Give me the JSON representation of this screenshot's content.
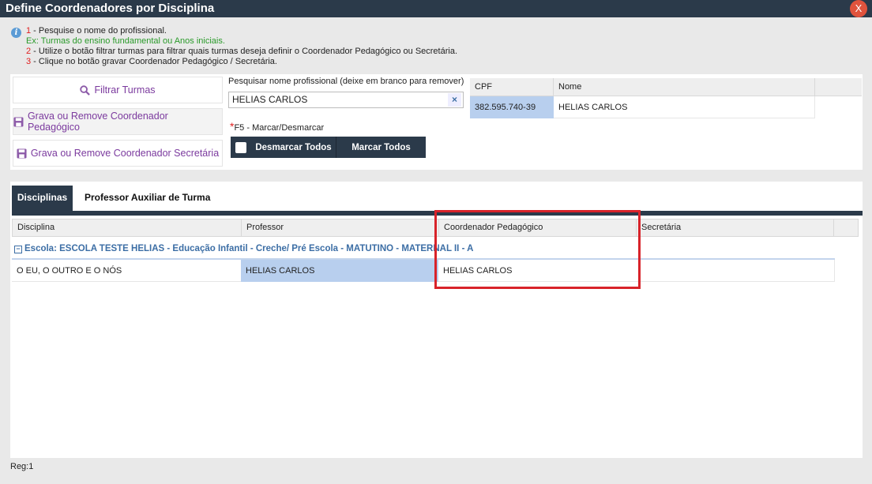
{
  "window": {
    "title": "Define Coordenadores por Disciplina",
    "close_label": "X"
  },
  "instructions": [
    {
      "num": "1",
      "text": " - Pesquise o nome do profissional."
    },
    {
      "num": "",
      "text": "Ex: Turmas do ensino fundamental ou Anos iniciais."
    },
    {
      "num": "2",
      "text": " - Utilize o botão filtrar turmas para filtrar quais turmas deseja definir o Coordenador Pedagógico ou Secretária."
    },
    {
      "num": "3",
      "text": " - Clique no botão gravar Coordenador Pedagógico / Secretária."
    }
  ],
  "buttons": {
    "filter": "Filtrar Turmas",
    "save_coord": "Grava ou Remove Coordenador Pedagógico",
    "save_sec": "Grava ou Remove Coordenador Secretária"
  },
  "search": {
    "label": "Pesquisar nome profissional (deixe em branco para remover)",
    "value": "HELIAS CARLOS",
    "clear": "×"
  },
  "shortcut": {
    "star": "*",
    "text": "F5 - Marcar/Desmarcar"
  },
  "toggle": {
    "uncheck_all": "Desmarcar Todos",
    "check_all": "Marcar Todos"
  },
  "profissionais": {
    "columns": [
      "CPF",
      "Nome"
    ],
    "rows": [
      {
        "cpf": "382.595.740-39",
        "nome": "HELIAS CARLOS"
      }
    ]
  },
  "tabs": [
    {
      "label": "Disciplinas"
    },
    {
      "label": "Professor Auxiliar de Turma"
    }
  ],
  "grid": {
    "columns": [
      "Disciplina",
      "Professor",
      "Coordenador Pedagógico",
      "Secretária"
    ],
    "group": {
      "icon": "−",
      "label": "Escola: ESCOLA TESTE HELIAS - Educação Infantil - Creche/ Pré Escola - MATUTINO - MATERNAL II - A"
    },
    "rows": [
      {
        "disciplina": "O EU, O OUTRO E O NÓS",
        "professor": "HELIAS CARLOS",
        "coordenador": "HELIAS CARLOS",
        "secretaria": ""
      }
    ]
  },
  "footer": {
    "reg": "Reg:1"
  },
  "colors": {
    "header": "#2b3a4a",
    "accent_purple": "#7b3a9e",
    "link_blue": "#3c6ea5",
    "highlight_red": "#d8232a",
    "selected_cell": "#b8cfee"
  }
}
